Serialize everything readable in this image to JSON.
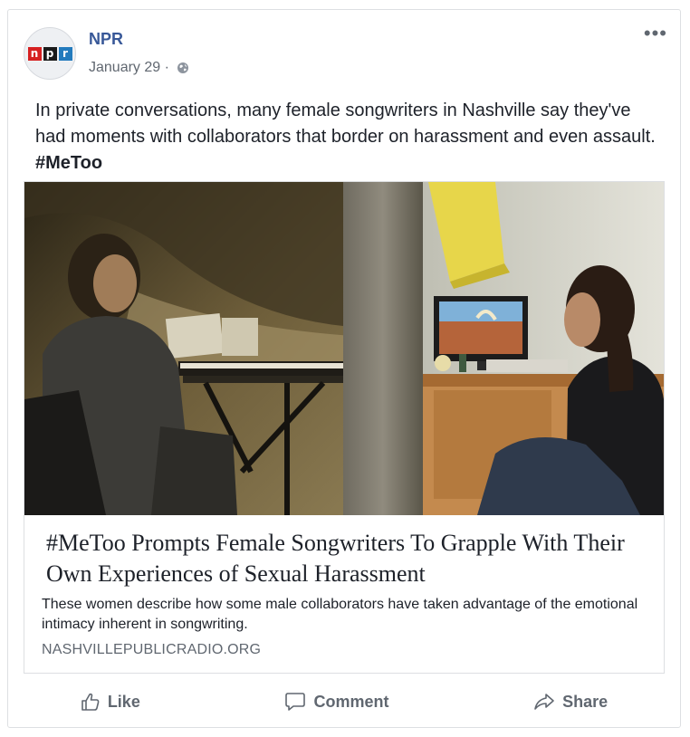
{
  "post": {
    "page_name": "NPR",
    "date": "January 29",
    "separator": " · ",
    "text": "In private conversations, many female songwriters in Nashville say they've had moments with collaborators that border on harassment and even assault. ",
    "hashtag": "#MeToo",
    "avatar_letters": [
      "n",
      "p",
      "r"
    ],
    "more_label": "•••"
  },
  "link": {
    "headline": "#MeToo Prompts Female Songwriters To Grapple With Their Own Experiences of Sexual Harassment",
    "description": "These women describe how some male collaborators have taken advantage of the emotional intimacy inherent in songwriting.",
    "domain": "NASHVILLEPUBLICRADIO.ORG"
  },
  "actions": {
    "like": "Like",
    "comment": "Comment",
    "share": "Share"
  },
  "icons": {
    "avatar": "npr-logo-icon",
    "privacy": "globe-icon",
    "more": "more-options-icon",
    "like": "thumbs-up-icon",
    "comment": "speech-bubble-icon",
    "share": "share-arrow-icon"
  },
  "colors": {
    "page_name": "#385898",
    "meta": "#606770",
    "text": "#1d2129",
    "npr_red": "#d62021",
    "npr_black": "#1a1a1a",
    "npr_blue": "#237bbd"
  }
}
